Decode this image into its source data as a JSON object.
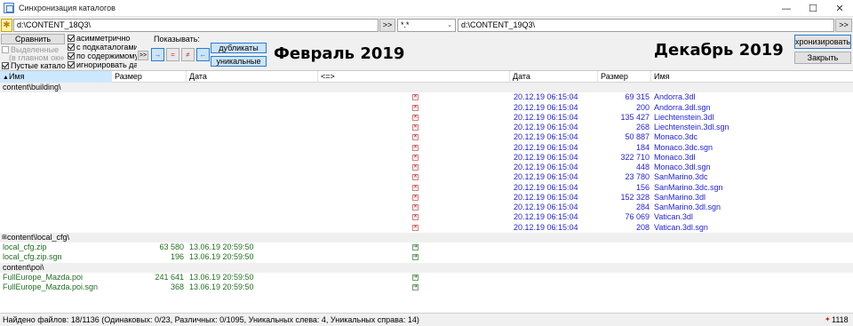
{
  "window": {
    "title": "Синхронизация каталогов",
    "minimize": "—",
    "maximize": "☐",
    "close": "✕"
  },
  "paths": {
    "left": "d:\\CONTENT_18Q3\\",
    "left_browse": ">>",
    "mask": "*.*",
    "right": "d:\\CONTENT_19Q3\\",
    "right_browse": ">>"
  },
  "options": {
    "compare_button": "Сравнить",
    "selected_label": "Выделенные",
    "in_main_window": "(в главном окне)",
    "empty_catalogs": "Пустые каталоги",
    "asymmetric": "асимметрично",
    "with_subdirs": "с подкаталогами",
    "by_content": "по содержимому",
    "content_more": ">>",
    "ignore_date": "игнорировать дату",
    "show_label": "Показывать:",
    "show_left": "→",
    "show_equal": "=",
    "show_diff": "≠",
    "show_right": "←",
    "duplicates_button": "дубликаты",
    "unique_button": "уникальные",
    "left_caption": "Февраль 2019",
    "right_caption": "Декабрь 2019",
    "synchronize_button": "Синхронизировать",
    "close_button": "Закрыть"
  },
  "columns": {
    "left_name": "Имя",
    "left_size": "Размер",
    "left_date": "Дата",
    "compare": "<=>",
    "right_date": "Дата",
    "right_size": "Размер",
    "right_name": "Имя"
  },
  "groups": [
    {
      "folder": "content\\building\\",
      "rows": [
        {
          "name": "Andorra.3dl",
          "size": "69 315",
          "date": "20.12.19 06:15:04"
        },
        {
          "name": "Andorra.3dl.sgn",
          "size": "200",
          "date": "20.12.19 06:15:04"
        },
        {
          "name": "Liechtenstein.3dl",
          "size": "135 427",
          "date": "20.12.19 06:15:04"
        },
        {
          "name": "Liechtenstein.3dl.sgn",
          "size": "268",
          "date": "20.12.19 06:15:04"
        },
        {
          "name": "Monaco.3dc",
          "size": "50 887",
          "date": "20.12.19 06:15:04"
        },
        {
          "name": "Monaco.3dc.sgn",
          "size": "184",
          "date": "20.12.19 06:15:04"
        },
        {
          "name": "Monaco.3dl",
          "size": "322 710",
          "date": "20.12.19 06:15:04"
        },
        {
          "name": "Monaco.3dl.sgn",
          "size": "448",
          "date": "20.12.19 06:15:04"
        },
        {
          "name": "SanMarino.3dc",
          "size": "23 780",
          "date": "20.12.19 06:15:04"
        },
        {
          "name": "SanMarino.3dc.sgn",
          "size": "156",
          "date": "20.12.19 06:15:04"
        },
        {
          "name": "SanMarino.3dl",
          "size": "152 328",
          "date": "20.12.19 06:15:04"
        },
        {
          "name": "SanMarino.3dl.sgn",
          "size": "284",
          "date": "20.12.19 06:15:04"
        },
        {
          "name": "Vatican.3dl",
          "size": "76 069",
          "date": "20.12.19 06:15:04"
        },
        {
          "name": "Vatican.3dl.sgn",
          "size": "208",
          "date": "20.12.19 06:15:04"
        }
      ]
    },
    {
      "folder": "content\\local_cfg\\",
      "rows": [
        {
          "name": "local_cfg.zip",
          "size": "63 580",
          "date": "13.06.19 20:59:50"
        },
        {
          "name": "local_cfg.zip.sgn",
          "size": "196",
          "date": "13.06.19 20:59:50"
        }
      ]
    },
    {
      "folder": "content\\poi\\",
      "rows": [
        {
          "name": "FullEurope_Mazda.poi",
          "size": "241 641",
          "date": "13.06.19 20:59:50"
        },
        {
          "name": "FullEurope_Mazda.poi.sgn",
          "size": "368",
          "date": "13.06.19 20:59:50"
        }
      ]
    }
  ],
  "status": {
    "text": "Найдено файлов: 18/1136  (Одинаковых: 0/23, Различных: 0/1095, Уникальных слева: 4, Уникальных справа: 14)",
    "right_count": "1118"
  },
  "colors": {
    "right_only": "#2222dd",
    "left_only": "#207020",
    "folder_bg": "#f0f0f0"
  }
}
